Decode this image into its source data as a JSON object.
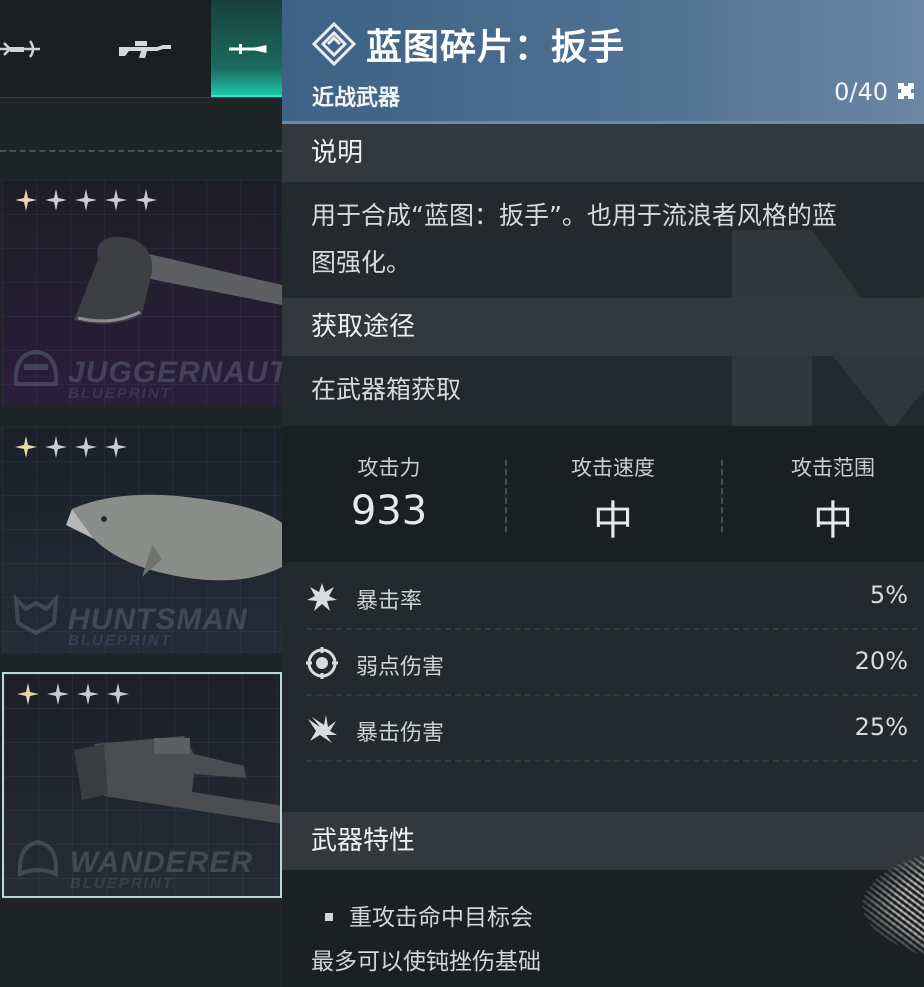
{
  "left_panel": {
    "weapon_tabs": [
      {
        "icon": "crossbow-icon",
        "active": false
      },
      {
        "icon": "rifle-icon",
        "active": false
      },
      {
        "icon": "melee-blade-icon",
        "active": true
      }
    ],
    "cards": [
      {
        "stars": 5,
        "item_icon": "axe-icon",
        "brand": "JUGGERNAUT",
        "brand_sub": "BLUEPRINT",
        "selected": false
      },
      {
        "stars": 4,
        "item_icon": "fish-icon",
        "brand": "HUNTSMAN",
        "brand_sub": "BLUEPRINT",
        "selected": false
      },
      {
        "stars": 4,
        "item_icon": "wrench-icon",
        "brand": "WANDERER",
        "brand_sub": "BLUEPRINT",
        "selected": true
      }
    ]
  },
  "detail": {
    "title": "蓝图碎片：扳手",
    "category": "近战武器",
    "count": "0/40",
    "description_heading": "说明",
    "description_line1": "用于合成“蓝图：扳手”。也用于流浪者风格的蓝",
    "description_line2": "图强化。",
    "source_heading": "获取途径",
    "source_text": "在武器箱获取",
    "stats": [
      {
        "label": "攻击力",
        "value": "933"
      },
      {
        "label": "攻击速度",
        "value": "中"
      },
      {
        "label": "攻击范围",
        "value": "中"
      }
    ],
    "attributes": [
      {
        "icon": "burst-icon",
        "name": "暴击率",
        "value": "5%"
      },
      {
        "icon": "target-icon",
        "name": "弱点伤害",
        "value": "20%"
      },
      {
        "icon": "shatter-icon",
        "name": "暴击伤害",
        "value": "25%"
      }
    ],
    "traits_heading": "武器特性",
    "trait_line1": "重攻击命中目标会",
    "trait_line2": "最多可以使钝挫伤基础",
    "colors": {
      "header": "#4a6d8f",
      "accent_tab": "#1fd1b2",
      "selected_border": "#b8d8d4"
    }
  }
}
